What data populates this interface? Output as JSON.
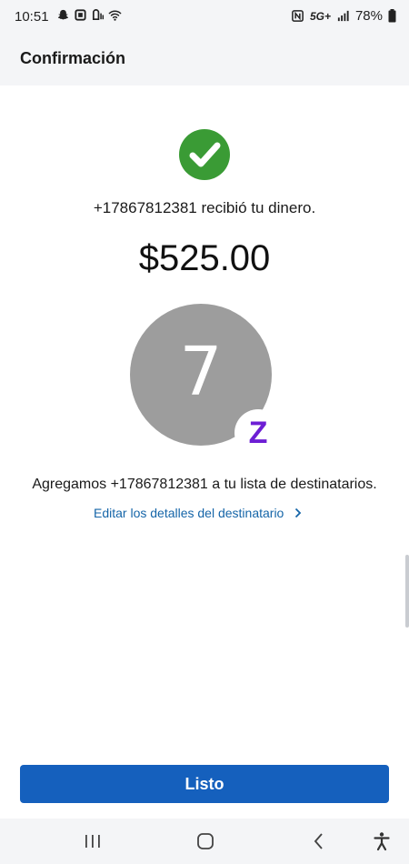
{
  "status_bar": {
    "time": "10:51",
    "network": "5G+",
    "battery": "78%"
  },
  "header": {
    "title": "Confirmación"
  },
  "confirmation": {
    "received_message": "+17867812381 recibió tu dinero.",
    "amount": "$525.00",
    "avatar_initial": "7",
    "badge_letter": "Z",
    "added_message": "Agregamos +17867812381 a tu lista de destinatarios.",
    "edit_link_label": "Editar los detalles del destinatario"
  },
  "actions": {
    "done_label": "Listo"
  },
  "colors": {
    "success_green": "#3a9b35",
    "primary_blue": "#1560bd",
    "link_blue": "#1565a8",
    "zelle_purple": "#6d1ed4",
    "avatar_gray": "#9d9d9d"
  },
  "icons": {
    "success": "checkmark-icon",
    "edit_link": "chevron-right-icon",
    "nav": [
      "recent-apps-icon",
      "home-icon",
      "back-icon",
      "accessibility-icon"
    ]
  }
}
